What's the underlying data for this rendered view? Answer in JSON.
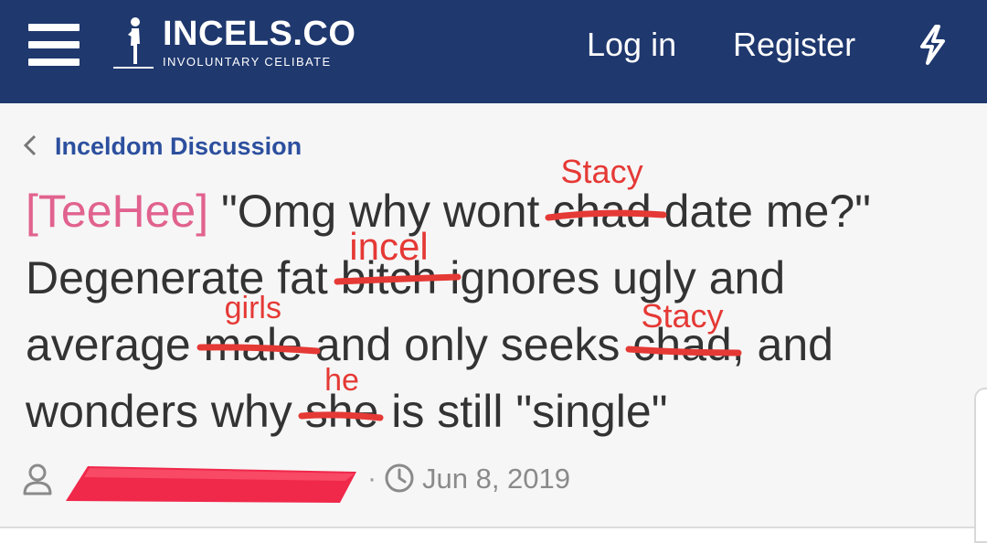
{
  "header": {
    "logo_title": "INCELS.CO",
    "logo_subtitle": "INVOLUNTARY CELIBATE",
    "login_label": "Log in",
    "register_label": "Register",
    "menu_icon": "hamburger-menu-icon",
    "whats_new_icon": "lightning-bolt-icon"
  },
  "breadcrumb": {
    "label": "Inceldom Discussion",
    "icon": "chevron-left-icon"
  },
  "thread": {
    "prefix": "[TeeHee]",
    "line1": {
      "before": "\"Omg why wont ",
      "struck": "chad",
      "annotation": "Stacy",
      "after": " date me?\""
    },
    "line2": {
      "before": "Degenerate fat ",
      "struck": "bitch",
      "annotation": "incel",
      "after": " ignores ugly and"
    },
    "line3": {
      "before": "average ",
      "struck1": "male",
      "annotation1": "girls",
      "middle": " and only seeks ",
      "struck2": "chad",
      "annotation2": "Stacy",
      "after": ", and"
    },
    "line4": {
      "before": "wonders why ",
      "struck": "she",
      "annotation": "he",
      "after": " is still \"single\""
    }
  },
  "meta": {
    "user_icon": "user-icon",
    "separator": "·",
    "clock_icon": "clock-icon",
    "date": "Jun 8, 2019"
  },
  "colors": {
    "header_bg": "#1f386e",
    "link": "#2c4f9e",
    "prefix": "#e1628e",
    "annotation_red": "#e53935",
    "redaction": "#f0284a"
  }
}
